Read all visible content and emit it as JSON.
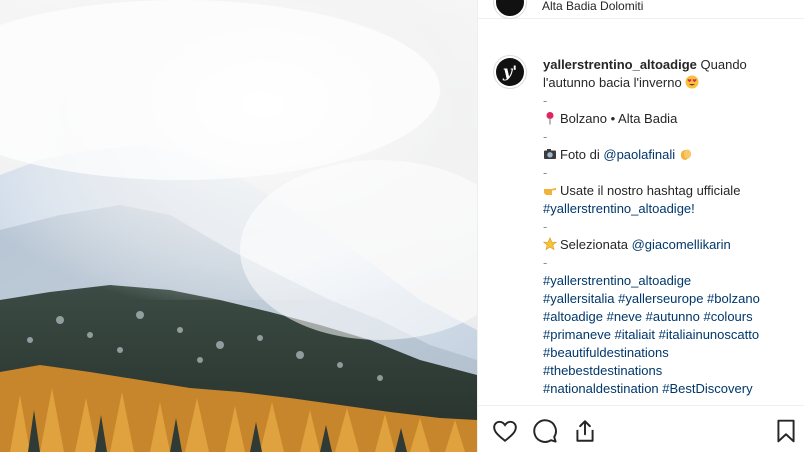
{
  "header": {
    "location": "Alta Badia Dolomiti"
  },
  "post": {
    "username": "yallerstrentino_altoadige",
    "avatar_letter": "y'",
    "lines": {
      "title_a": "Quando",
      "title_b": "l'autunno bacia l'inverno",
      "dash": "-",
      "place": "Bolzano • Alta Badia",
      "photo_prefix": "Foto di",
      "photo_user": "@paolafinali",
      "hashtag_text": "Usate il nostro hashtag ufficiale",
      "hashtag_official": "#yallerstrentino_altoadige!",
      "selected_prefix": "Selezionata",
      "selected_user": "@giacomellikarin",
      "tags1": "#yallerstrentino_altoadige",
      "tags2": "#yallersitalia #yallerseurope #bolzano",
      "tags3": "#altoadige #neve #autunno #colours",
      "tags4": "#primaneve #italiait #italiainunoscatto",
      "tags5": "#beautifuldestinations",
      "tags6": "#thebestdestinations",
      "tags7": "#nationaldestination #BestDiscovery"
    }
  },
  "icons": {
    "like": "heart-icon",
    "comment": "comment-icon",
    "share": "share-icon",
    "save": "bookmark-icon"
  }
}
